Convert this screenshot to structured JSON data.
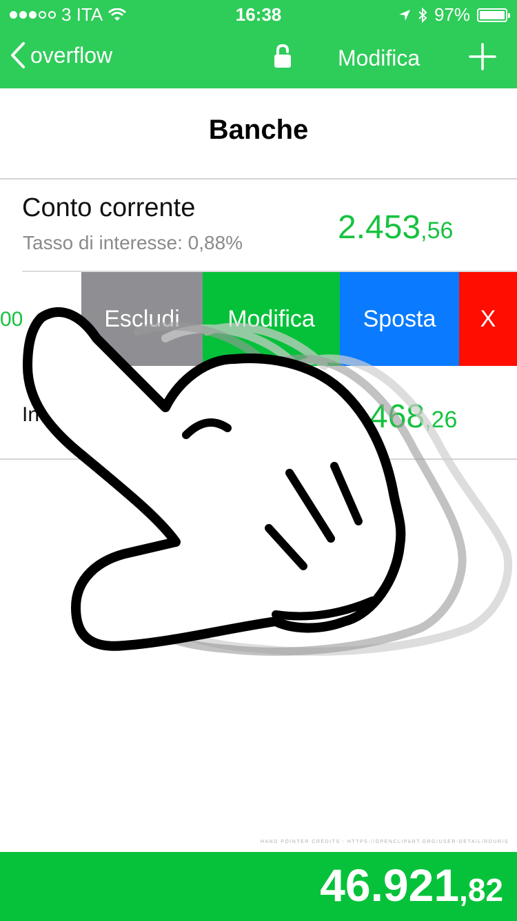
{
  "status": {
    "carrier": "3 ITA",
    "time": "16:38",
    "battery": "97%"
  },
  "nav": {
    "back_label": "overflow",
    "edit_label": "Modifica"
  },
  "page": {
    "title": "Banche"
  },
  "accounts": [
    {
      "name": "Conto corrente",
      "subtitle": "Tasso di interesse: 0,88%",
      "amount_int": "2.453",
      "amount_dec": ",56"
    },
    {
      "amount_partial": "00"
    },
    {
      "name_partial": "Inv",
      "amount_int": "468",
      "amount_dec": ",26"
    }
  ],
  "swipe_actions": {
    "exclude": "Escludi",
    "edit": "Modifica",
    "move": "Sposta",
    "delete": "X"
  },
  "colors": {
    "accent": "#2ecc59",
    "amount": "#16c23f",
    "exclude": "#8e8e93",
    "edit": "#05c13a",
    "move": "#0a7bff",
    "delete": "#ff0d00"
  },
  "credit": "HAND POINTER CREDITS : HTTPS://OPENCLIPART.ORG/USER-DETAIL/RDURIS",
  "total": {
    "int": "46.921",
    "dec": ",82"
  }
}
